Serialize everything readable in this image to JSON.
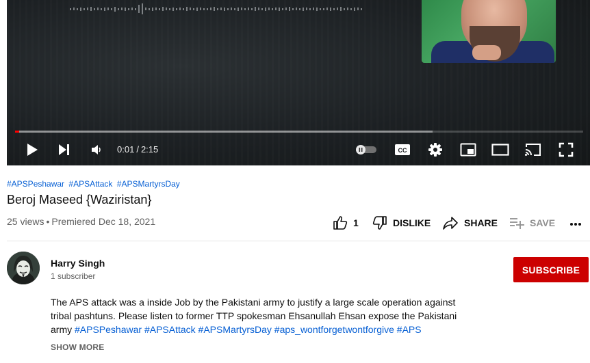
{
  "player": {
    "current_time": "0:01",
    "separator": "/",
    "duration": "2:15",
    "played_fraction": 0.007,
    "buffered_fraction": 0.735,
    "icons": [
      "play-icon",
      "next-icon",
      "volume-icon",
      "autoplay-toggle-icon",
      "captions-icon",
      "settings-icon",
      "miniplayer-icon",
      "theater-icon",
      "cast-icon",
      "fullscreen-icon"
    ]
  },
  "video": {
    "hashtags": [
      "#APSPeshawar",
      "#APSAttack",
      "#APSMartyrsDay"
    ],
    "title": "Beroj Maseed {Waziristan}",
    "views": "25 views",
    "meta_separator": "•",
    "premiered": "Premiered Dec 18, 2021"
  },
  "actions": {
    "like_count": "1",
    "dislike_label": "DISLIKE",
    "share_label": "SHARE",
    "save_label": "SAVE"
  },
  "channel": {
    "name": "Harry Singh",
    "subscribers": "1 subscriber",
    "subscribe_label": "SUBSCRIBE"
  },
  "description": {
    "text": "The APS attack was a inside Job by the Pakistani army to justify a large scale operation against tribal pashtuns. Please listen to former TTP spokesman Ehsanullah Ehsan expose the Pakistani army ",
    "tags": [
      "#APSPeshawar",
      "#APSAttack",
      "#APSMartyrsDay",
      "#aps_wontforgetwontforgive",
      "#APS"
    ],
    "show_more_label": "SHOW MORE"
  },
  "colors": {
    "link": "#065fd4",
    "subscribe": "#cc0000",
    "progress_played": "#ff0000"
  }
}
